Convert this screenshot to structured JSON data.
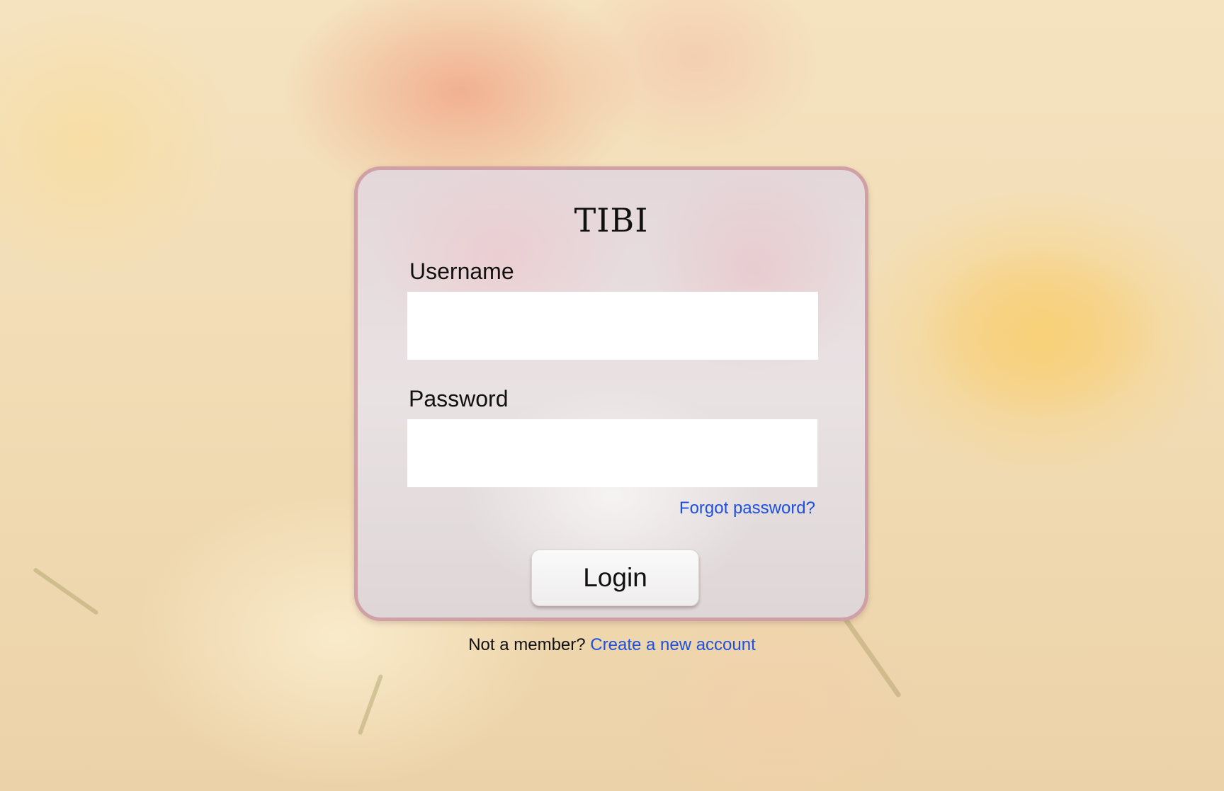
{
  "app": {
    "title": "TIBI"
  },
  "form": {
    "username_label": "Username",
    "username_value": "",
    "password_label": "Password",
    "password_value": "",
    "forgot_link": "Forgot password?",
    "login_button": "Login"
  },
  "footer": {
    "prompt": "Not a member?",
    "signup_link": "Create a new account"
  },
  "colors": {
    "link": "#1d4fe0",
    "card_border": "#cfa1a7",
    "input_bg": "#ffffff"
  }
}
